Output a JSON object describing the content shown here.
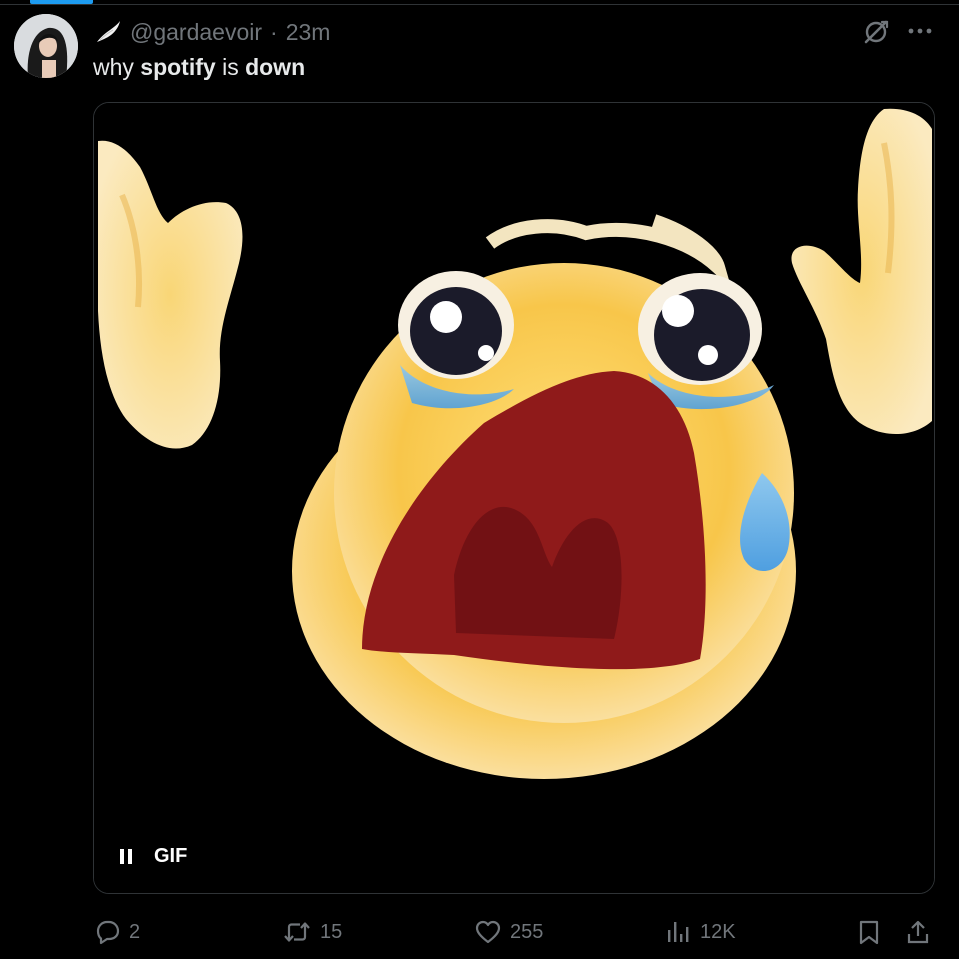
{
  "tweet": {
    "handle": "@gardaevoir",
    "separator": "·",
    "time": "23m",
    "text_parts": [
      {
        "text": "why ",
        "bold": false
      },
      {
        "text": "spotify",
        "bold": true
      },
      {
        "text": " is ",
        "bold": false
      },
      {
        "text": "down",
        "bold": true
      }
    ],
    "media": {
      "badge": "GIF",
      "state": "playing"
    }
  },
  "actions": {
    "replies": "2",
    "reposts": "15",
    "likes": "255",
    "views": "12K"
  },
  "icons": {
    "header": [
      "wing-icon",
      "grok-icon",
      "more-icon"
    ],
    "actions": [
      "reply-icon",
      "repost-icon",
      "like-icon",
      "views-icon",
      "bookmark-icon",
      "share-icon"
    ],
    "media": [
      "pause-icon"
    ]
  },
  "colors": {
    "background": "#000000",
    "text": "#e7e9ea",
    "secondary": "#71767b",
    "accent": "#1d9bf0",
    "border": "#2f3336"
  }
}
